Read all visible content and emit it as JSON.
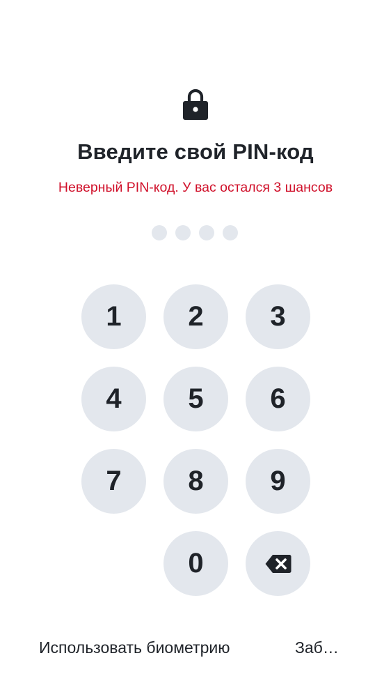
{
  "header": {
    "icon": "lock-icon",
    "title": "Введите свой PIN-код",
    "error": "Неверный PIN-код. У вас остался 3 шансов"
  },
  "pin": {
    "length": 4,
    "filled": 0
  },
  "keypad": {
    "k1": "1",
    "k2": "2",
    "k3": "3",
    "k4": "4",
    "k5": "5",
    "k6": "6",
    "k7": "7",
    "k8": "8",
    "k9": "9",
    "k0": "0",
    "backspace_icon": "backspace-icon"
  },
  "footer": {
    "biometrics": "Использовать биометрию",
    "forgot": "Заб…"
  },
  "colors": {
    "text": "#1f2329",
    "error": "#d0102a",
    "key_background": "#e3e7ed",
    "background": "#ffffff"
  }
}
